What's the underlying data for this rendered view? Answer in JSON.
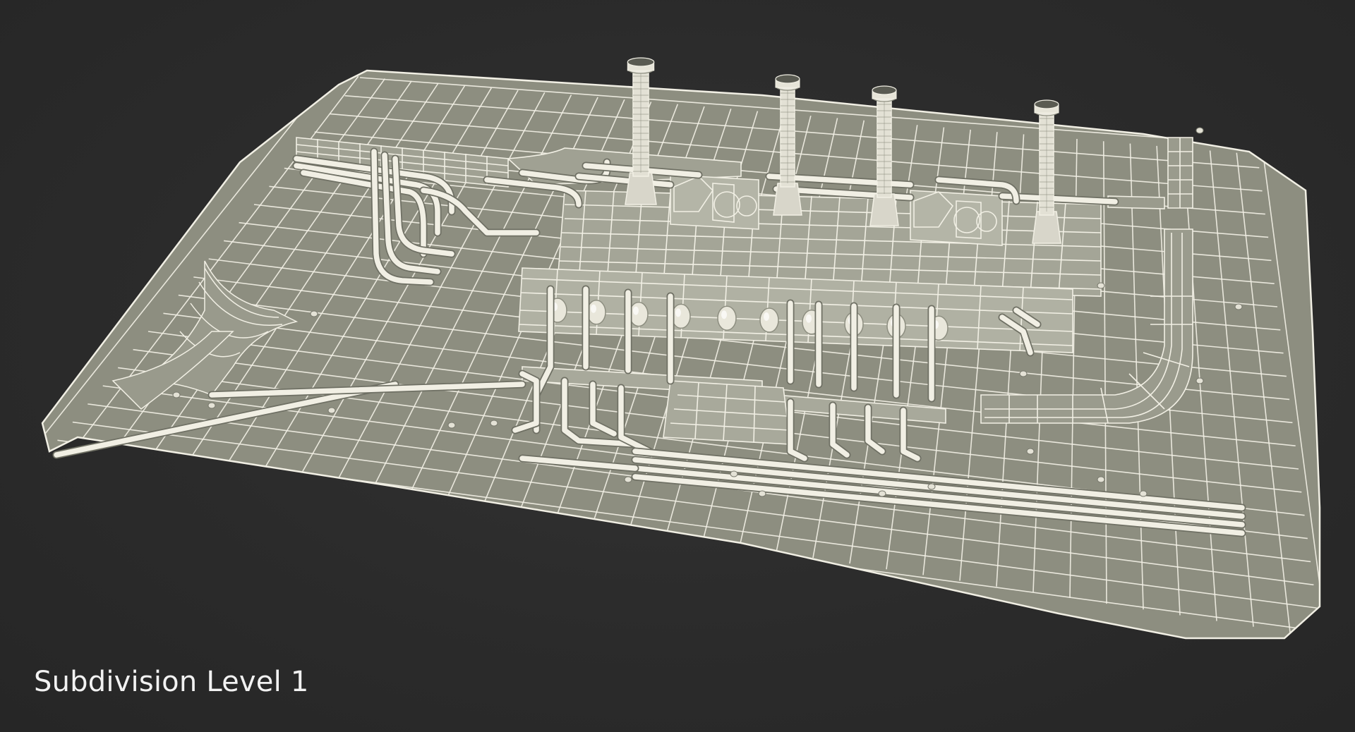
{
  "caption": "Subdivision Level 1",
  "colors": {
    "background": "#2a2a2a",
    "ground": "#8d8e80",
    "wire": "#f1efe4",
    "caption": "#f2f2f2"
  },
  "scene": {
    "subject": "wireframe industrial power plant model",
    "icons": [
      "smokestack",
      "pipe",
      "tank",
      "ground-grid"
    ]
  }
}
